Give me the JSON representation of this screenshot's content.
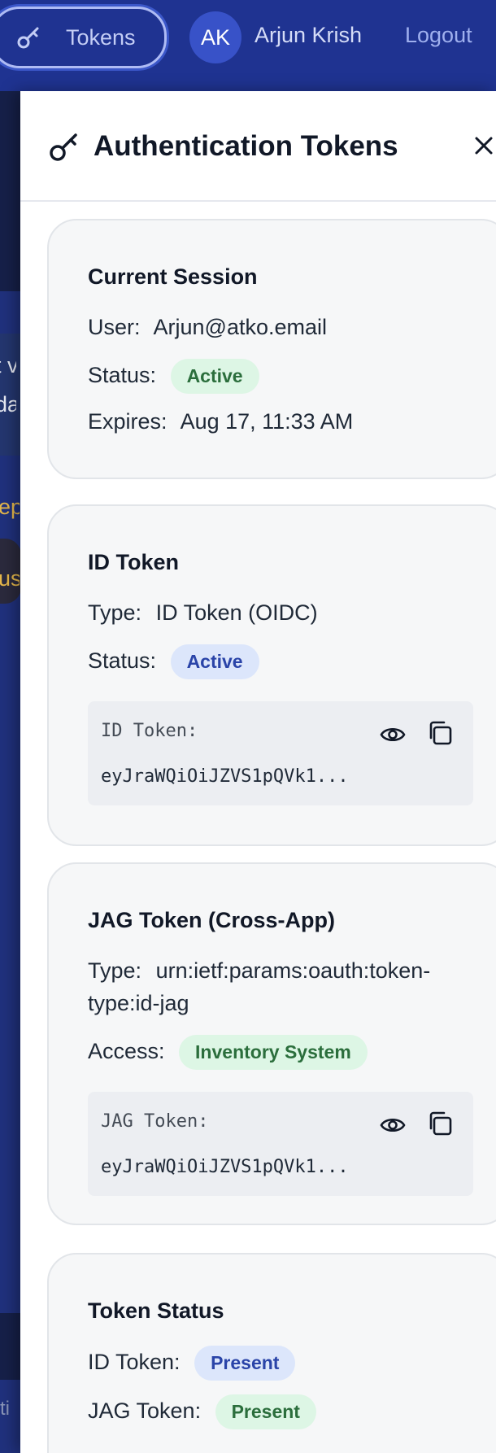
{
  "nav": {
    "tokens_label": "Tokens",
    "avatar_initials": "AK",
    "user_name": "Arjun Krish",
    "logout_label": "Logout"
  },
  "background": {
    "frag_1": "t v",
    "frag_2": "da",
    "frag_3": "ep",
    "frag_4": "us",
    "frag_5": "ti"
  },
  "panel": {
    "title": "Authentication Tokens"
  },
  "session": {
    "title": "Current Session",
    "user_label": "User:",
    "user_value": "Arjun@atko.email",
    "status_label": "Status:",
    "status_value": "Active",
    "expires_label": "Expires:",
    "expires_value": "Aug 17, 11:33 AM"
  },
  "id_token": {
    "title": "ID Token",
    "type_label": "Type:",
    "type_value": "ID Token (OIDC)",
    "status_label": "Status:",
    "status_value": "Active",
    "box_label": "ID Token:",
    "box_value": "eyJraWQiOiJZVS1pQVk1..."
  },
  "jag_token": {
    "title": "JAG Token (Cross-App)",
    "type_label": "Type:",
    "type_value_line1": "urn:ietf:params:oauth:token-",
    "type_value_line2": "type:id-jag",
    "access_label": "Access:",
    "access_value": "Inventory System",
    "box_label": "JAG Token:",
    "box_value": "eyJraWQiOiJZVS1pQVk1..."
  },
  "token_status": {
    "title": "Token Status",
    "id_label": "ID Token:",
    "id_value": "Present",
    "jag_label": "JAG Token:",
    "jag_value": "Present"
  },
  "colors": {
    "nav_bg": "#1f3391",
    "badge_green_bg": "#ddf6e5",
    "badge_green_text": "#2b6e3c",
    "badge_blue_bg": "#dce6fb",
    "badge_blue_text": "#2a44a8"
  }
}
